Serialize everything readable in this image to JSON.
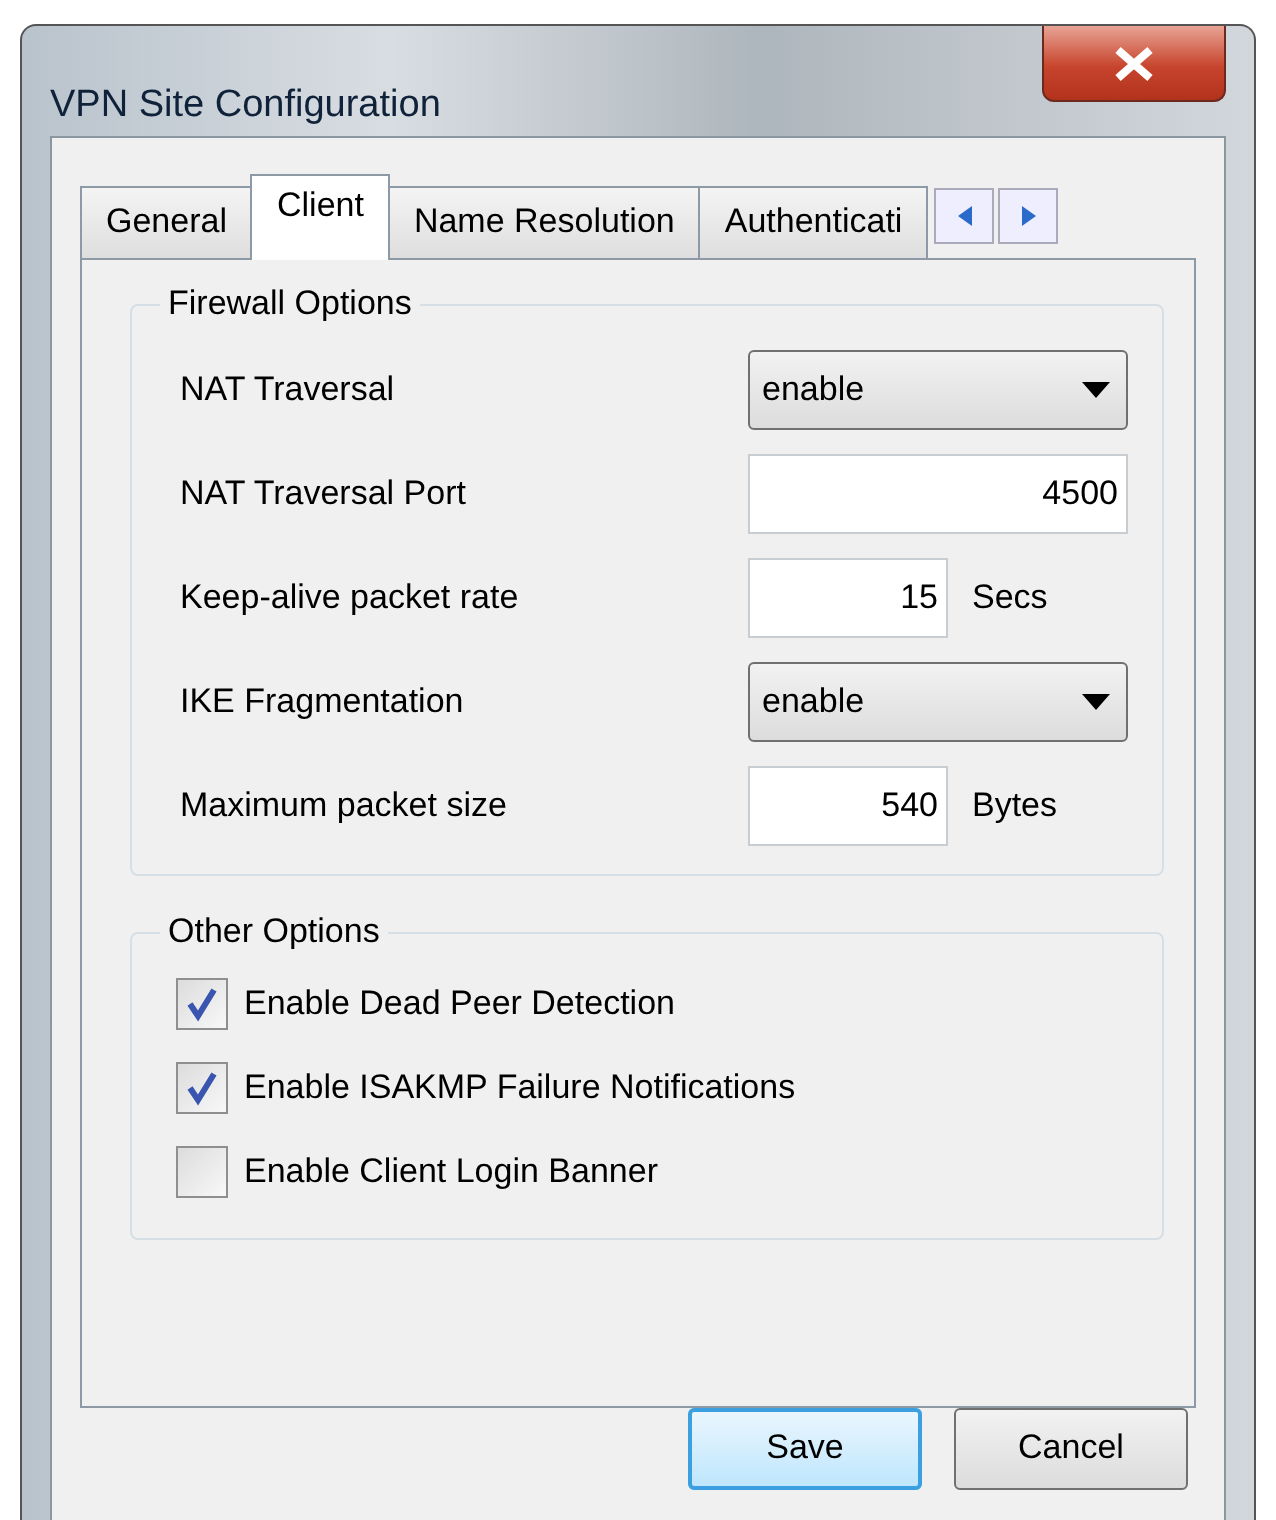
{
  "window": {
    "title": "VPN Site Configuration"
  },
  "tabs": [
    {
      "label": "General",
      "selected": false
    },
    {
      "label": "Client",
      "selected": true
    },
    {
      "label": "Name Resolution",
      "selected": false
    },
    {
      "label": "Authenticati",
      "selected": false
    }
  ],
  "firewall_options": {
    "title": "Firewall Options",
    "fields": [
      {
        "kind": "select",
        "label": "NAT Traversal",
        "value": "enable"
      },
      {
        "kind": "number",
        "label": "NAT Traversal Port",
        "value": "4500"
      },
      {
        "kind": "number",
        "label": "Keep-alive packet rate",
        "value": "15",
        "unit": "Secs"
      },
      {
        "kind": "select",
        "label": "IKE Fragmentation",
        "value": "enable"
      },
      {
        "kind": "number",
        "label": "Maximum packet size",
        "value": "540",
        "unit": "Bytes"
      }
    ]
  },
  "other_options": {
    "title": "Other Options",
    "checkboxes": [
      {
        "label": "Enable Dead Peer Detection",
        "checked": true
      },
      {
        "label": "Enable ISAKMP Failure Notifications",
        "checked": true
      },
      {
        "label": "Enable Client Login Banner",
        "checked": false
      }
    ]
  },
  "buttons": [
    {
      "label": "Save",
      "kind": "default"
    },
    {
      "label": "Cancel",
      "kind": "normal"
    }
  ]
}
